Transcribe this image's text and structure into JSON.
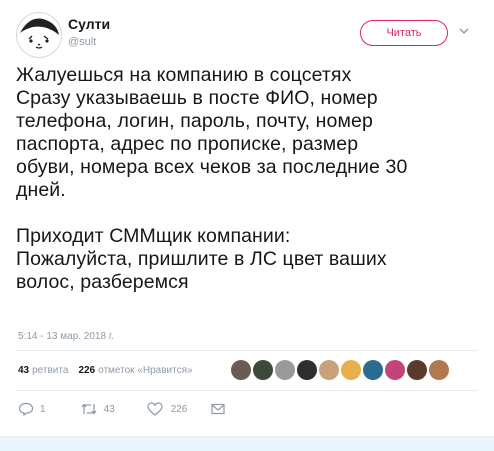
{
  "user": {
    "name": "Султи",
    "handle": "@sult"
  },
  "follow_label": "Читать",
  "tweet": {
    "text": "Жалуешься на компанию в соцсетях\nСразу указываешь в посте ФИО, номер\nтелефона, логин, пароль, почту, номер\nпаспорта, адрес по прописке, размер\nобуви, номера всех чеков за последние 30\nдней.\n\nПриходит СММщик компании:\nПожалуйста, пришлите в ЛС цвет ваших\nволос, разберемся",
    "timestamp": "5:14 - 13 мар. 2018 г."
  },
  "stats": {
    "retweets_count": "43",
    "retweets_label": "ретвита",
    "likes_count": "226",
    "likes_label": "отметок «Нравится»"
  },
  "actions": {
    "reply_count": "1",
    "retweet_count": "43",
    "like_count": "226"
  },
  "colors": {
    "accent": "#e0245e",
    "muted": "#8e9aa6",
    "text": "#14171a",
    "divider": "#e6ecf0"
  },
  "likers": [
    "#6b5b55",
    "#3d4a3a",
    "#9a9a9a",
    "#2e2e2e",
    "#c8a27a",
    "#e8b04a",
    "#2a6b8f",
    "#c2457a",
    "#5a3b2b",
    "#b07a4f"
  ]
}
